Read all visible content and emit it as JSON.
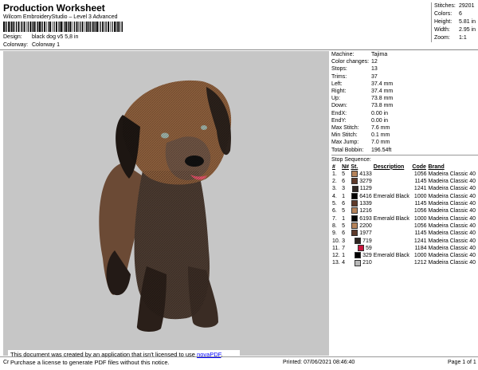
{
  "header": {
    "title": "Production Worksheet",
    "software": "Wilcom EmbroideryStudio – Level 3 Advanced",
    "design_label": "Design:",
    "design_value": "black dog v5 5,8 in",
    "colorway_label": "Colorway:",
    "colorway_value": "Colorway 1"
  },
  "top_stats": [
    {
      "label": "Stitches:",
      "value": "29201"
    },
    {
      "label": "Colors:",
      "value": "6"
    },
    {
      "label": "Height:",
      "value": "5.81 in"
    },
    {
      "label": "Width:",
      "value": "2.95 in"
    },
    {
      "label": "Zoom:",
      "value": "1:1"
    }
  ],
  "machine_info": [
    {
      "label": "Machine:",
      "value": "Tajima"
    },
    {
      "label": "Color changes:",
      "value": "12"
    },
    {
      "label": "Stops:",
      "value": "13"
    },
    {
      "label": "Trims:",
      "value": "37"
    },
    {
      "label": "Left:",
      "value": "37.4 mm"
    },
    {
      "label": "Right:",
      "value": "37.4 mm"
    },
    {
      "label": "Up:",
      "value": "73.8 mm"
    },
    {
      "label": "Down:",
      "value": "73.8 mm"
    },
    {
      "label": "EndX:",
      "value": "0.00 in"
    },
    {
      "label": "EndY:",
      "value": "0.00 in"
    },
    {
      "label": "Max Stitch:",
      "value": "7.6 mm"
    },
    {
      "label": "Min Stitch:",
      "value": "0.1 mm"
    },
    {
      "label": "Max Jump:",
      "value": "7.0 mm"
    },
    {
      "label": "Total Bobbin:",
      "value": "196.54ft"
    }
  ],
  "stop_sequence": {
    "title": "Stop Sequence:",
    "headers": {
      "num": "#",
      "n": "N#",
      "st": "St.",
      "desc": "Description",
      "code": "Code",
      "brand": "Brand"
    },
    "rows": [
      {
        "num": "1.",
        "n": "5",
        "color": "#b5835a",
        "st": "4133",
        "desc": "",
        "code": "1056",
        "brand": "Madeira Classic 40"
      },
      {
        "num": "2.",
        "n": "6",
        "color": "#5e3a2a",
        "st": "3279",
        "desc": "",
        "code": "1145",
        "brand": "Madeira Classic 40"
      },
      {
        "num": "3.",
        "n": "3",
        "color": "#2e2622",
        "st": "1129",
        "desc": "",
        "code": "1241",
        "brand": "Madeira Classic 40"
      },
      {
        "num": "4.",
        "n": "1",
        "color": "#000000",
        "st": "6416",
        "desc": "Emerald Black",
        "code": "1000",
        "brand": "Madeira Classic 40"
      },
      {
        "num": "5.",
        "n": "6",
        "color": "#5e3a2a",
        "st": "1339",
        "desc": "",
        "code": "1145",
        "brand": "Madeira Classic 40"
      },
      {
        "num": "6.",
        "n": "5",
        "color": "#b5835a",
        "st": "1216",
        "desc": "",
        "code": "1056",
        "brand": "Madeira Classic 40"
      },
      {
        "num": "7.",
        "n": "1",
        "color": "#000000",
        "st": "6193",
        "desc": "Emerald Black",
        "code": "1000",
        "brand": "Madeira Classic 40"
      },
      {
        "num": "8.",
        "n": "5",
        "color": "#b5835a",
        "st": "2200",
        "desc": "",
        "code": "1056",
        "brand": "Madeira Classic 40"
      },
      {
        "num": "9.",
        "n": "6",
        "color": "#5e3a2a",
        "st": "1977",
        "desc": "",
        "code": "1145",
        "brand": "Madeira Classic 40"
      },
      {
        "num": "10.",
        "n": "3",
        "color": "#2e2622",
        "st": "719",
        "desc": "",
        "code": "1241",
        "brand": "Madeira Classic 40"
      },
      {
        "num": "11.",
        "n": "7",
        "color": "#c8143c",
        "st": "59",
        "desc": "",
        "code": "1184",
        "brand": "Madeira Classic 40"
      },
      {
        "num": "12.",
        "n": "1",
        "color": "#000000",
        "st": "329",
        "desc": "Emerald Black",
        "code": "1000",
        "brand": "Madeira Classic 40"
      },
      {
        "num": "13.",
        "n": "4",
        "color": "#b9b9b9",
        "st": "210",
        "desc": "",
        "code": "1212",
        "brand": "Madeira Classic 40"
      }
    ]
  },
  "notice": {
    "line1_prefix": "This document was created by an application that isn't licensed to use ",
    "link": "novaPDF",
    "line1_suffix": ".",
    "line2": "Purchase a license to generate PDF files without this notice."
  },
  "footer": {
    "left": "Cr",
    "printed": "Printed: 07/06/2021 08:46:40",
    "page": "Page 1 of 1"
  },
  "colors": {
    "image_bg": "#c6c6c6",
    "link": "#0000ff"
  }
}
